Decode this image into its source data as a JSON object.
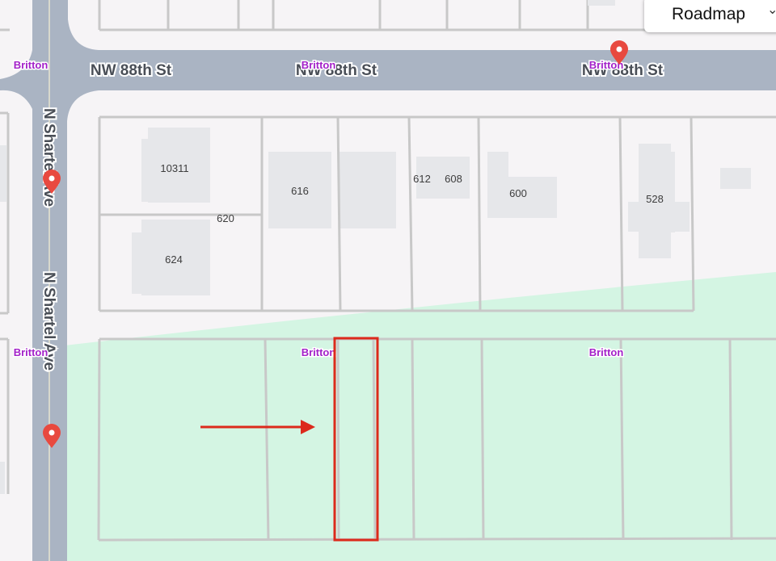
{
  "map": {
    "streets": {
      "nw_88th_1": "NW 88th St",
      "nw_88th_2": "NW 88th St",
      "nw_88th_3": "NW 88th St",
      "shartel_1": "N Shartel Ave",
      "shartel_2": "N Shartel Ave"
    },
    "area_labels": {
      "top_left": "Britton",
      "top_mid": "Britton",
      "top_right": "Britton",
      "bottom_left": "Britton",
      "bottom_mid": "Britton",
      "bottom_right": "Britton"
    },
    "addresses": {
      "a10311": "10311",
      "a616": "616",
      "a612": "612",
      "a608": "608",
      "a600": "600",
      "a528": "528",
      "a620": "620",
      "a624": "624"
    },
    "icons": {
      "pin": "map-pin-icon",
      "arrow": "arrow-right-icon"
    },
    "colors": {
      "road": "#aab4c3",
      "park": "#d4f5e3",
      "building": "#e6e7ea",
      "parcel_line": "#c8c8c8",
      "pin": "#e8493f",
      "highlight": "#dc2a1c",
      "area_label": "#a321c9"
    }
  },
  "controls": {
    "map_type": "Roadmap",
    "chevron": "⌄"
  }
}
